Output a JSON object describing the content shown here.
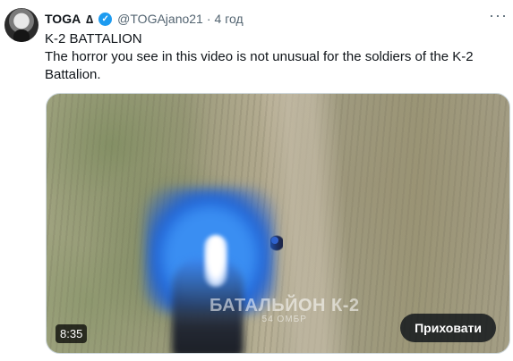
{
  "tweet": {
    "display_name": "TOGA",
    "name_symbol": "∆",
    "handle": "@TOGAjano21",
    "separator": "·",
    "timestamp": "4 год",
    "more_label": "···",
    "text_title": "K-2 BATTALION",
    "text_body": "The horror you see in this video is not unusual for the soldiers of the K-2 Battalion."
  },
  "media": {
    "watermark_main": "БАТАЛЬЙОН К-2",
    "watermark_sub": "54 ОМБР",
    "duration": "8:35",
    "hide_button_label": "Приховати"
  },
  "colors": {
    "verified_badge": "#1d9bf0",
    "text_secondary": "#536471"
  }
}
